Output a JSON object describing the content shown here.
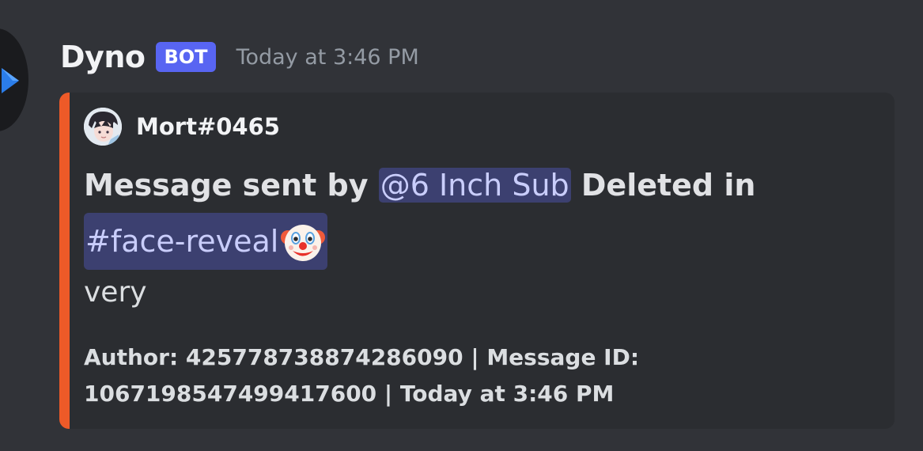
{
  "message": {
    "username": "Dyno",
    "bot_tag": "BOT",
    "timestamp": "Today at 3:46 PM"
  },
  "embed": {
    "accent_color": "#ed5a28",
    "author_name": "Mort#0465",
    "title_prefix": "Message sent by ",
    "user_mention": "@6 Inch Sub",
    "title_middle": " Deleted in",
    "channel_mention": "#face-reveal",
    "channel_emoji": "clown-face-icon",
    "description": "very",
    "footer": "Author: 425778738874286090 | Message ID: 1067198547499417600 | Today at 3:46 PM"
  },
  "colors": {
    "background": "#313338",
    "embed_background": "#2b2d31",
    "mention_background": "#3c4070",
    "mention_text": "#c9cdfb",
    "bot_tag": "#5865f2"
  }
}
